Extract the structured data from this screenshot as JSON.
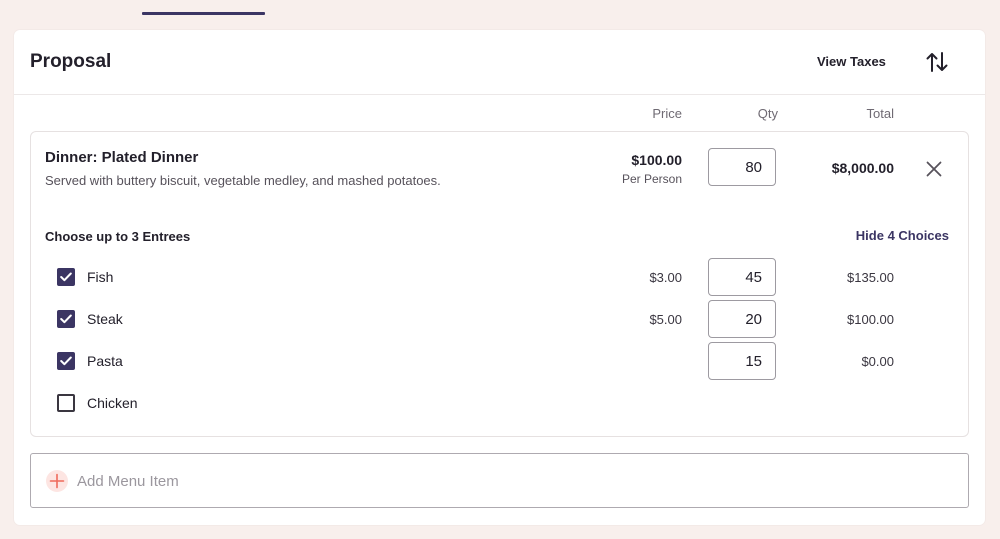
{
  "header": {
    "title": "Proposal",
    "view_taxes_label": "View Taxes",
    "sort_icon": "sort-arrows-icon"
  },
  "columns": {
    "price": "Price",
    "qty": "Qty",
    "total": "Total"
  },
  "menu_item": {
    "title": "Dinner: Plated Dinner",
    "description": "Served with buttery biscuit, vegetable medley, and mashed potatoes.",
    "price": "$100.00",
    "price_unit": "Per Person",
    "qty": "80",
    "total": "$8,000.00",
    "remove_icon": "close-icon",
    "choices_label": "Choose up to 3 Entrees",
    "hide_choices_label": "Hide 4 Choices",
    "choices": [
      {
        "name": "Fish",
        "checked": true,
        "price": "$3.00",
        "qty": "45",
        "total": "$135.00"
      },
      {
        "name": "Steak",
        "checked": true,
        "price": "$5.00",
        "qty": "20",
        "total": "$100.00"
      },
      {
        "name": "Pasta",
        "checked": true,
        "price": "",
        "qty": "15",
        "total": "$0.00"
      },
      {
        "name": "Chicken",
        "checked": false,
        "price": "",
        "qty": "",
        "total": ""
      }
    ]
  },
  "add_item": {
    "placeholder": "Add Menu Item",
    "icon": "plus-icon"
  },
  "colors": {
    "background": "#f8efec",
    "accent": "#3b3563",
    "plus_icon_bg": "#fde5e2",
    "plus_icon": "#ef6a5b"
  }
}
